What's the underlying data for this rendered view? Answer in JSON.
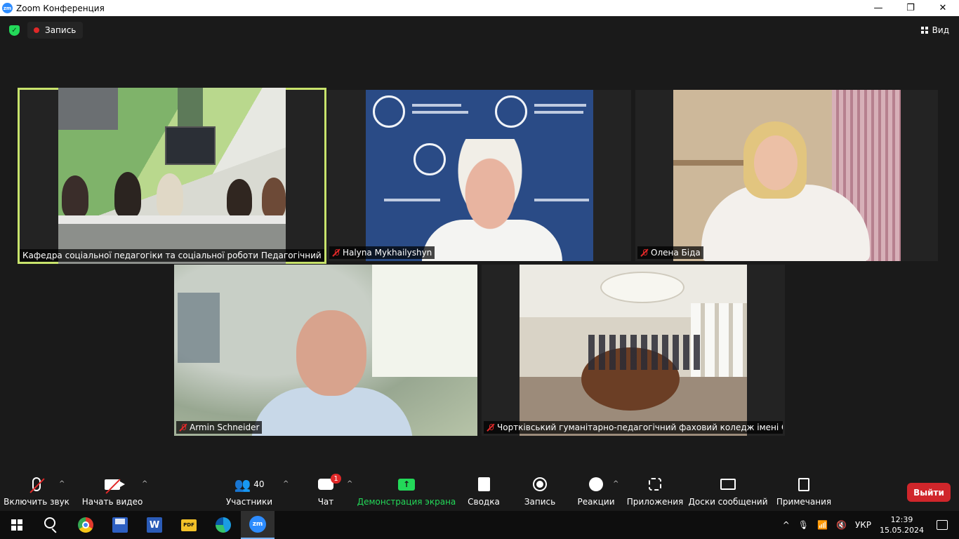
{
  "window": {
    "title": "Zoom Конференция",
    "logo_text": "zm",
    "controls": {
      "minimize": "—",
      "restore": "❐",
      "close": "✕"
    }
  },
  "topbar": {
    "security_icon": "shield-check-icon",
    "recording_label": "Запись",
    "view_label": "Вид"
  },
  "participants": [
    {
      "name": "Кафедра соціальної педагогіки та соціальної роботи Педагогічний ф...",
      "muted": false,
      "active_speaker": true
    },
    {
      "name": "Halyna Mykhailyshyn",
      "muted": true,
      "active_speaker": false
    },
    {
      "name": "Олена Біда",
      "muted": true,
      "active_speaker": false
    },
    {
      "name": "Armin Schneider",
      "muted": true,
      "active_speaker": false
    },
    {
      "name": "Чортківський гуманітарно-педагогічний фаховий коледж імені Ол...",
      "muted": true,
      "active_speaker": false
    }
  ],
  "toolbar": {
    "unmute_label": "Включить звук",
    "start_video_label": "Начать видео",
    "participants_label": "Участники",
    "participants_count": "40",
    "chat_label": "Чат",
    "chat_badge": "1",
    "share_label": "Демонстрация экрана",
    "summary_label": "Сводка",
    "record_label": "Запись",
    "reactions_label": "Реакции",
    "apps_label": "Приложения",
    "whiteboards_label": "Доски сообщений",
    "notes_label": "Примечания",
    "leave_label": "Выйти",
    "caret": "^"
  },
  "taskbar": {
    "folder_app_text": "PDF",
    "word_app_text": "W",
    "zoom_app_text": "zm",
    "language": "УКР",
    "time": "12:39",
    "date": "15.05.2024",
    "tray_chevron": "^"
  },
  "colors": {
    "active_speaker_border": "#c8e36c",
    "leave_button": "#d0262b",
    "share_green": "#23d959",
    "muted_red": "#e02828"
  }
}
